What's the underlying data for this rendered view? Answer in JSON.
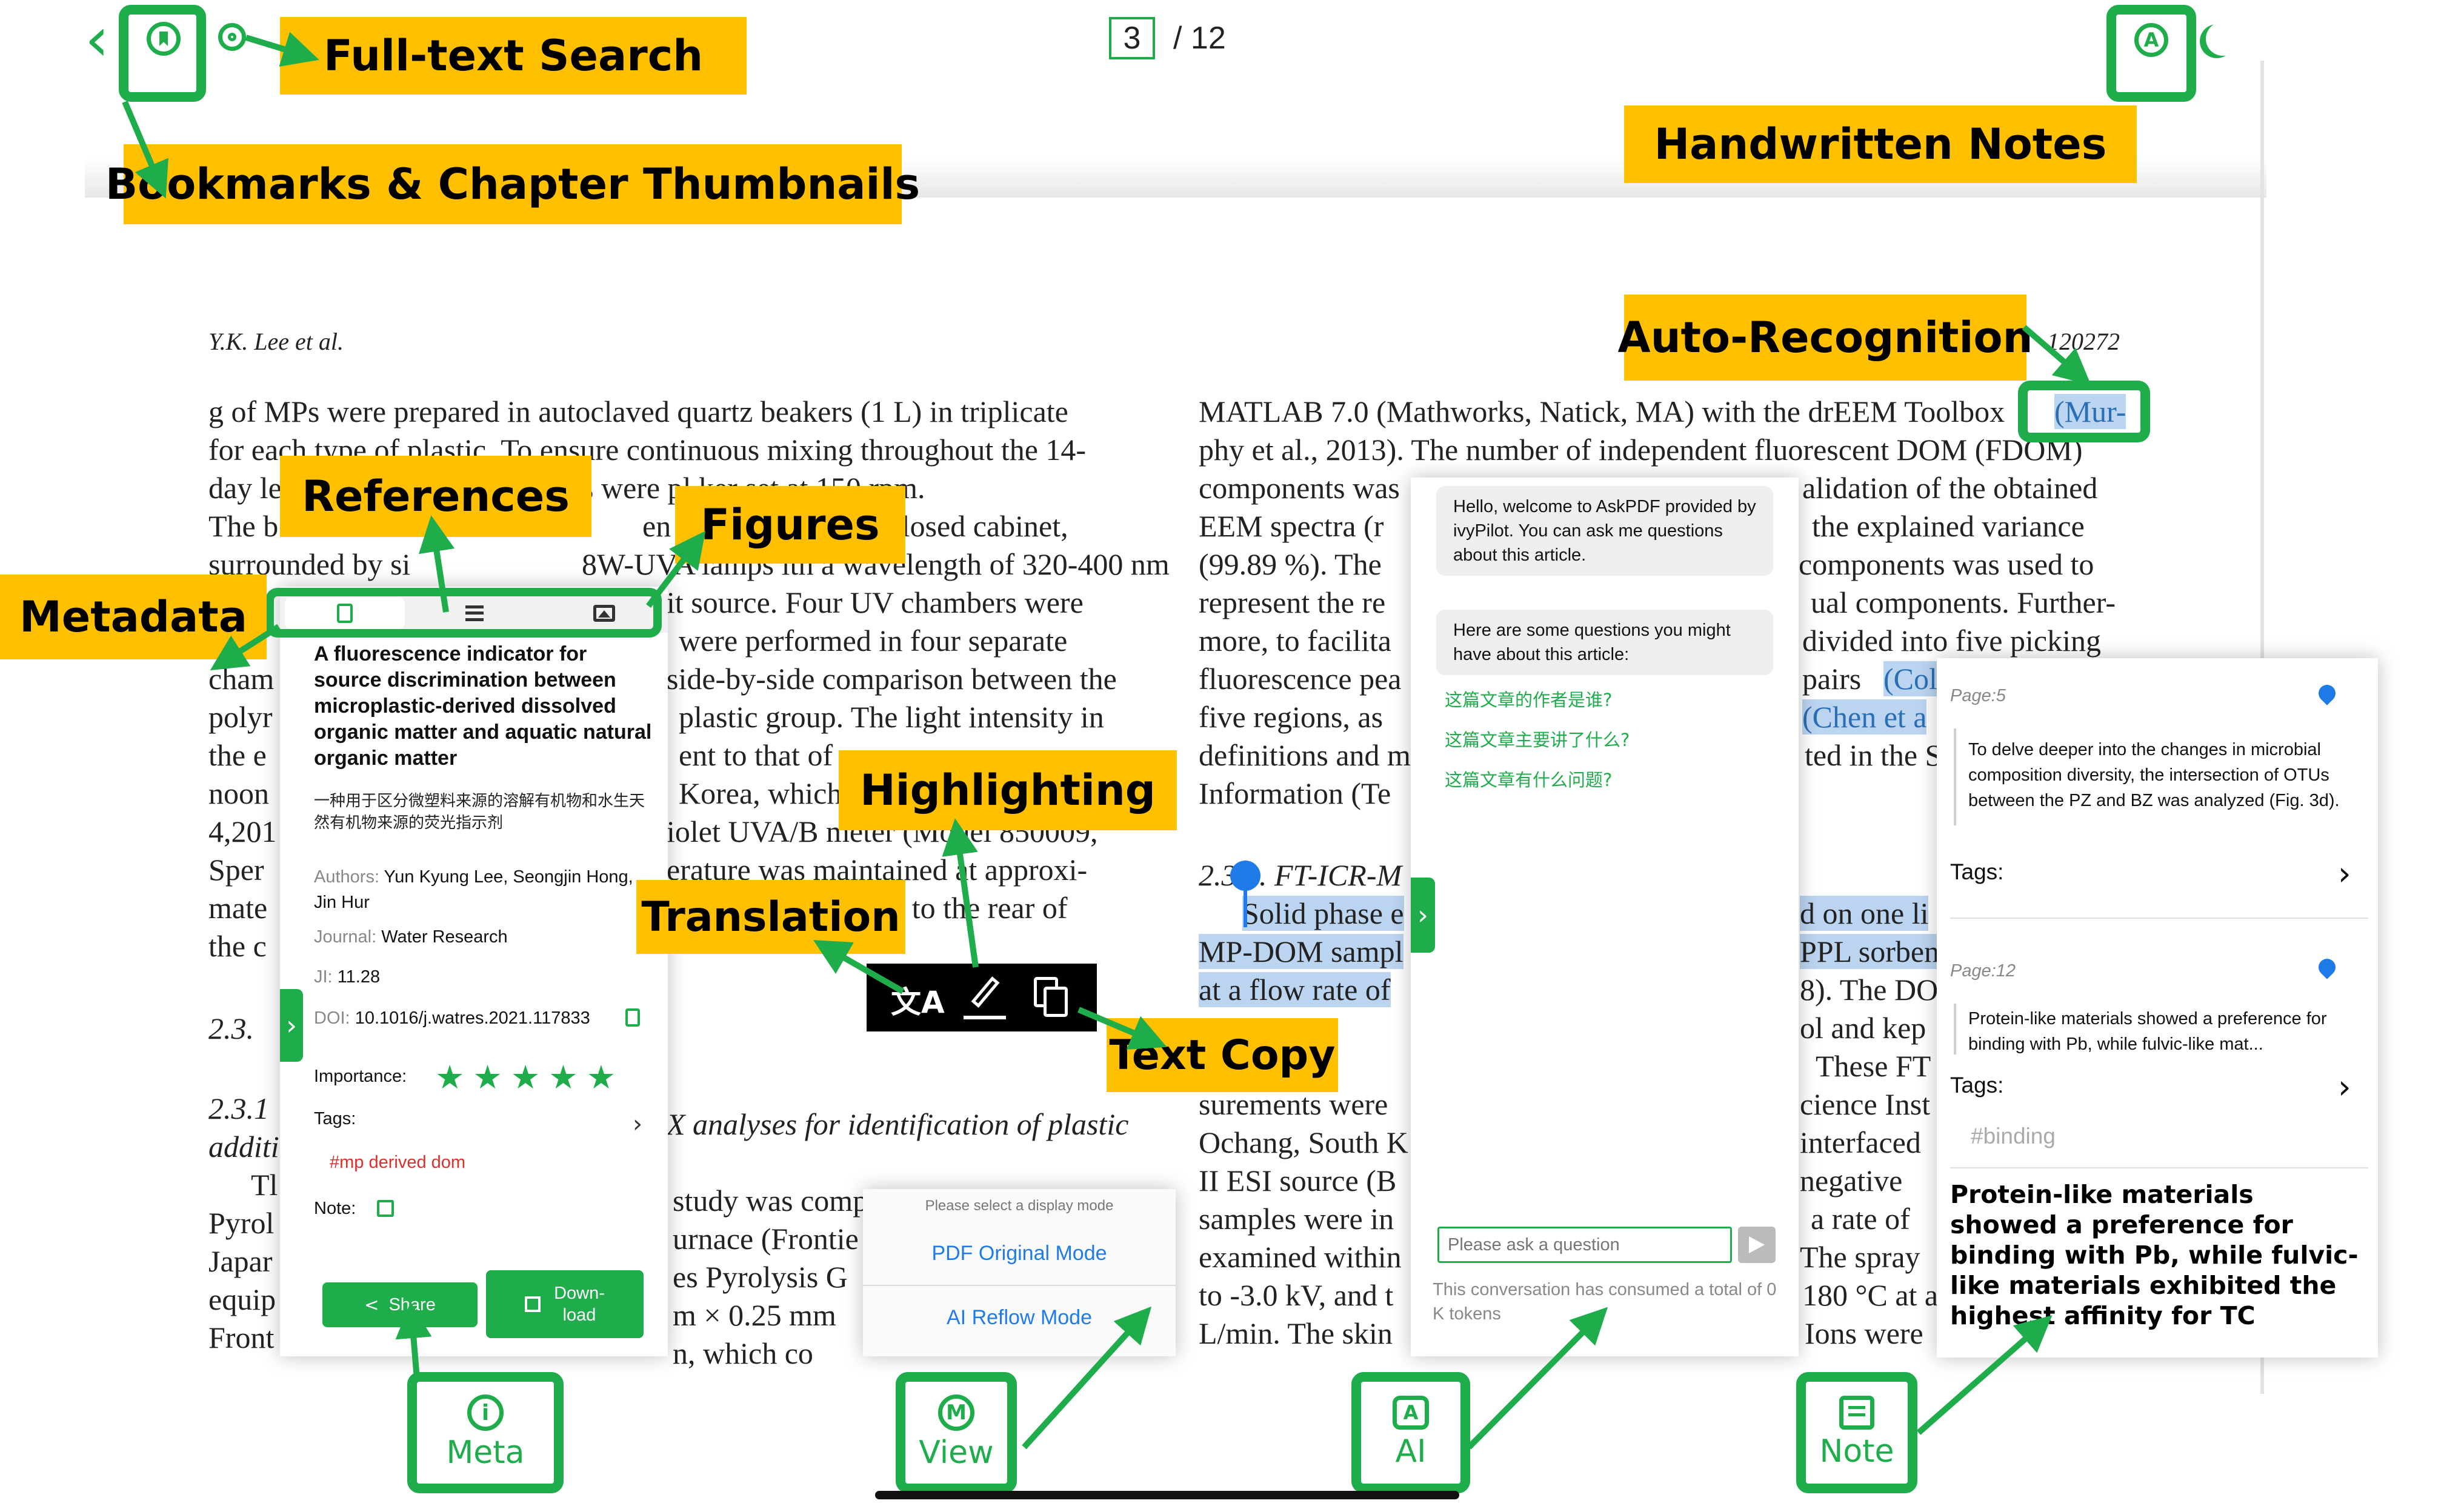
{
  "toolbar": {
    "back_glyph": "‹",
    "page_current": "3",
    "page_total": "/ 12"
  },
  "callouts": {
    "full_text_search": "Full-text Search",
    "bookmarks": "Bookmarks & Chapter Thumbnails",
    "handwritten_notes": "Handwritten Notes",
    "auto_recognition": "Auto-Recognition",
    "references": "References",
    "figures": "Figures",
    "metadata": "Metadata",
    "highlighting": "Highlighting",
    "translation": "Translation",
    "text_copy": "Text Copy"
  },
  "document": {
    "running_head_left": "Y.K. Lee et al.",
    "running_head_right": "120272",
    "left_lines": [
      "g of MPs were prepared in autoclaved quartz beakers (1 L) in triplicate",
      "for each type of plastic. To ensure continuous mixing throughout the 14-",
      "day le",
      "The b",
      "surrounded by si",
      "",
      "cham",
      "polyr",
      "the e",
      "noon",
      "4,201",
      "Sper",
      "mate",
      "the c",
      "",
      "2.3.",
      "",
      "2.3.1",
      "additi",
      "Tl",
      "Pyrol",
      "Japar",
      "equip",
      "Front"
    ],
    "mid_lines": [
      "s were pl                     ker set at 150 rpm.",
      "en positioned in  l   enclosed cabinet,",
      "8W-UVA lamps      ith a wavelength of 320-400 nm",
      "it source. Four UV chambers were",
      "were performed in four separate",
      "side-by-side comparison between the",
      "plastic group. The light intensity in",
      "ent to that of",
      "Korea, which",
      "iolet UVA/B meter (Model 850009,",
      "erature was maintained at approxi-",
      "hed to the rear of",
      "",
      "",
      "X analyses for identification of plastic",
      "",
      "study was composed of a Multi-Shot",
      "urnace (Frontie",
      "es Pyrolysis G",
      "m  ×  0.25 mm",
      "n,  which  co"
    ],
    "right_top_lines": [
      "MATLAB 7.0 (Mathworks, Natick, MA) with the drEEM Toolbox",
      "phy et al., 2013). The number of independent fluorescent DOM (FDOM)",
      "components was",
      "EEM spectra (r",
      "(99.89 %). The",
      "represent the re",
      "more, to facilita",
      "fluorescence pea",
      "five regions, as",
      "definitions and m",
      "Information (Te"
    ],
    "right_top_tail": [
      "alidation of the obtained",
      "the explained variance",
      "components was used to",
      "ual components. Further-",
      "divided into five picking",
      "pairs",
      "",
      "ted in the S"
    ],
    "ref_mur": "(Mur-",
    "ref_col": "(Col",
    "ref_chen": "(Chen et a",
    "section_label": "2.3.3.  FT-ICR-M",
    "right_mid_lines": [
      "Solid phase e",
      "MP-DOM sampl",
      "at a flow rate of",
      "",
      "",
      "surements were",
      "Ochang, South K",
      "II ESI source (B",
      "samples were in",
      "examined within",
      "to -3.0 kV, and t",
      "L/min. The skin"
    ],
    "right_mid_tail": [
      "d on one li",
      "PPL sorben",
      "8). The DO",
      "ol and kep",
      "These  FT",
      "cience Inst",
      "interfaced",
      "negative",
      "a rate of",
      "The spray",
      "180 °C at a",
      "Ions were"
    ]
  },
  "meta_panel": {
    "tab_doc_icon": "document-icon",
    "tab_list_icon": "list-icon",
    "tab_image_icon": "image-icon",
    "title": "A fluorescence indicator for source discrimination between microplastic-derived dissolved organic matter and aquatic natural organic matter",
    "title_zh": "一种用于区分微塑料来源的溶解有机物和水生天然有机物来源的荧光指示剂",
    "authors_label": "Authors:",
    "authors": "Yun Kyung Lee, Seongjin Hong, Jin Hur",
    "journal_label": "Journal:",
    "journal": "Water Research",
    "ji_label": "JI:",
    "ji": "11.28",
    "doi_label": "DOI:",
    "doi": "10.1016/j.watres.2021.117833",
    "importance_label": "Importance:",
    "importance_stars": 5,
    "tags_label": "Tags:",
    "tag": "#mp derived dom",
    "note_label": "Note:",
    "share_label": "Share",
    "download_label": "Down-\nload"
  },
  "selection_toolbar": {
    "translate_icon": "translate-icon",
    "highlight_icon": "highlighter-icon",
    "copy_icon": "copy-icon"
  },
  "view_panel": {
    "header": "Please select a display mode",
    "option1": "PDF Original Mode",
    "option2": "AI Reflow Mode"
  },
  "ai_panel": {
    "welcome": "Hello, welcome to AskPDF provided by ivyPilot. You can ask me questions about this article.",
    "suggest_intro": "Here are some questions you might have about this article:",
    "q1": "这篇文章的作者是谁?",
    "q2": "这篇文章主要讲了什么?",
    "q3": "这篇文章有什么问题?",
    "input_placeholder": "Please ask a question",
    "token_note": "This conversation has consumed a total of 0 K tokens"
  },
  "note_panel": {
    "n1_page": "Page:5",
    "n1_text": "To delve deeper into the changes in microbial composition diversity, the intersection of OTUs between the PZ and BZ was analyzed (Fig. 3d).",
    "n1_tags": "Tags:",
    "n2_page": "Page:12",
    "n2_text": "Protein-like materials showed a preference for binding with Pb, while fulvic-like mat...",
    "n2_tags": "Tags:",
    "n2_tag_value": "#binding",
    "n2_big": "Protein-like materials showed a preference for binding with Pb, while fulvic-like materials exhibited the highest affinity for TC"
  },
  "bottom_tabs": {
    "meta": "Meta",
    "view": "View",
    "ai": "AI",
    "note": "Note"
  },
  "colors": {
    "accent_green": "#1FAD4C",
    "callout_yellow": "#FFC000",
    "link_blue": "#2A6FB5"
  }
}
